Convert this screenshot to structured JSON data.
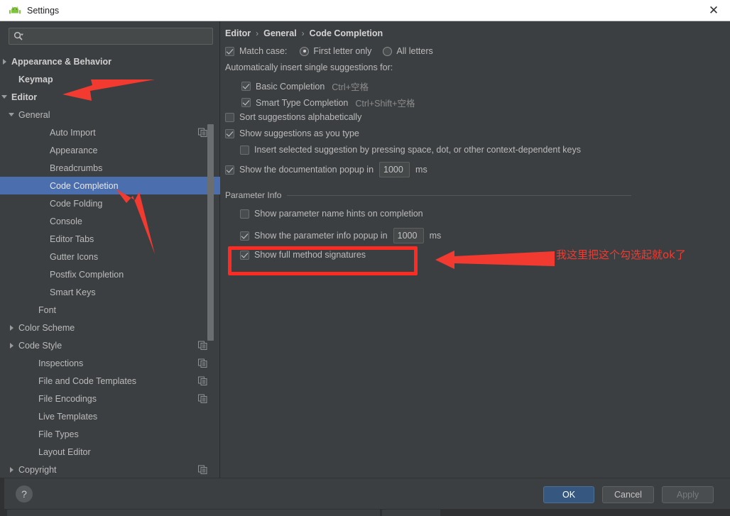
{
  "window": {
    "title": "Settings",
    "icon": "android-icon",
    "close_label": "✕"
  },
  "sidebar": {
    "search": {
      "placeholder": "",
      "value": "",
      "icon": "search-icon"
    },
    "items": [
      {
        "label": "Appearance & Behavior",
        "indent": 0,
        "arrow": "right",
        "bold": true,
        "selected": false,
        "module_icon": false
      },
      {
        "label": "Keymap",
        "indent": 1,
        "arrow": "none",
        "bold": true,
        "selected": false,
        "module_icon": false
      },
      {
        "label": "Editor",
        "indent": 0,
        "arrow": "down",
        "bold": true,
        "selected": false,
        "module_icon": false
      },
      {
        "label": "General",
        "indent": 1,
        "arrow": "down",
        "bold": false,
        "selected": false,
        "module_icon": false
      },
      {
        "label": "Auto Import",
        "indent": 3,
        "arrow": "none",
        "bold": false,
        "selected": false,
        "module_icon": true
      },
      {
        "label": "Appearance",
        "indent": 3,
        "arrow": "none",
        "bold": false,
        "selected": false,
        "module_icon": false
      },
      {
        "label": "Breadcrumbs",
        "indent": 3,
        "arrow": "none",
        "bold": false,
        "selected": false,
        "module_icon": false
      },
      {
        "label": "Code Completion",
        "indent": 3,
        "arrow": "none",
        "bold": false,
        "selected": true,
        "module_icon": false
      },
      {
        "label": "Code Folding",
        "indent": 3,
        "arrow": "none",
        "bold": false,
        "selected": false,
        "module_icon": false
      },
      {
        "label": "Console",
        "indent": 3,
        "arrow": "none",
        "bold": false,
        "selected": false,
        "module_icon": false
      },
      {
        "label": "Editor Tabs",
        "indent": 3,
        "arrow": "none",
        "bold": false,
        "selected": false,
        "module_icon": false
      },
      {
        "label": "Gutter Icons",
        "indent": 3,
        "arrow": "none",
        "bold": false,
        "selected": false,
        "module_icon": false
      },
      {
        "label": "Postfix Completion",
        "indent": 3,
        "arrow": "none",
        "bold": false,
        "selected": false,
        "module_icon": false
      },
      {
        "label": "Smart Keys",
        "indent": 3,
        "arrow": "none",
        "bold": false,
        "selected": false,
        "module_icon": false
      },
      {
        "label": "Font",
        "indent": 2,
        "arrow": "none",
        "bold": false,
        "selected": false,
        "module_icon": false
      },
      {
        "label": "Color Scheme",
        "indent": 1,
        "arrow": "right",
        "bold": false,
        "selected": false,
        "module_icon": false
      },
      {
        "label": "Code Style",
        "indent": 1,
        "arrow": "right",
        "bold": false,
        "selected": false,
        "module_icon": true
      },
      {
        "label": "Inspections",
        "indent": 2,
        "arrow": "none",
        "bold": false,
        "selected": false,
        "module_icon": true
      },
      {
        "label": "File and Code Templates",
        "indent": 2,
        "arrow": "none",
        "bold": false,
        "selected": false,
        "module_icon": true
      },
      {
        "label": "File Encodings",
        "indent": 2,
        "arrow": "none",
        "bold": false,
        "selected": false,
        "module_icon": true
      },
      {
        "label": "Live Templates",
        "indent": 2,
        "arrow": "none",
        "bold": false,
        "selected": false,
        "module_icon": false
      },
      {
        "label": "File Types",
        "indent": 2,
        "arrow": "none",
        "bold": false,
        "selected": false,
        "module_icon": false
      },
      {
        "label": "Layout Editor",
        "indent": 2,
        "arrow": "none",
        "bold": false,
        "selected": false,
        "module_icon": false
      },
      {
        "label": "Copyright",
        "indent": 1,
        "arrow": "right",
        "bold": false,
        "selected": false,
        "module_icon": true
      }
    ]
  },
  "content": {
    "breadcrumb": [
      "Editor",
      "General",
      "Code Completion"
    ],
    "breadcrumb_sep": "›",
    "match_case": {
      "label": "Match case:",
      "checked": true,
      "options": [
        {
          "label": "First letter only",
          "selected": true
        },
        {
          "label": "All letters",
          "selected": false
        }
      ]
    },
    "auto_insert_label": "Automatically insert single suggestions for:",
    "auto_insert": [
      {
        "label": "Basic Completion",
        "shortcut": "Ctrl+空格",
        "checked": true
      },
      {
        "label": "Smart Type Completion",
        "shortcut": "Ctrl+Shift+空格",
        "checked": true
      }
    ],
    "sort_alpha": {
      "label": "Sort suggestions alphabetically",
      "checked": false
    },
    "show_as_type": {
      "label": "Show suggestions as you type",
      "checked": true
    },
    "insert_selected": {
      "label": "Insert selected suggestion by pressing space, dot, or other context-dependent keys",
      "checked": false
    },
    "doc_popup": {
      "label_before": "Show the documentation popup in",
      "value": "1000",
      "label_after": "ms",
      "checked": true
    },
    "parameter_info": {
      "group_title": "Parameter Info",
      "name_hints": {
        "label": "Show parameter name hints on completion",
        "checked": false
      },
      "popup": {
        "label_before": "Show the parameter info popup in",
        "value": "1000",
        "label_after": "ms",
        "checked": true
      },
      "full_signatures": {
        "label": "Show full method signatures",
        "checked": true
      }
    }
  },
  "annotations": {
    "note_text": "我这里把这个勾选起就ok了",
    "highlight_color": "#ff2a22",
    "arrow_color": "#f23a31"
  },
  "footer": {
    "help_label": "?",
    "ok_label": "OK",
    "cancel_label": "Cancel",
    "apply_label": "Apply"
  }
}
